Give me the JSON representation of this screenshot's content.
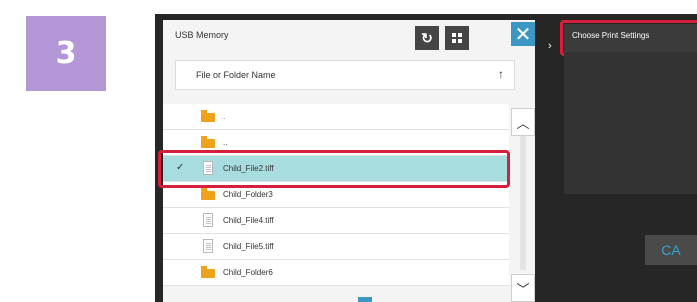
{
  "step_number": "3",
  "panel": {
    "title": "USB Memory",
    "refresh_icon": "refresh-icon",
    "grid_icon": "grid-view-icon",
    "close_icon": "close-icon",
    "sort_label": "File or Folder Name",
    "sort_arrow": "↑"
  },
  "files": [
    {
      "name": ".",
      "type": "folder",
      "selected": false
    },
    {
      "name": "..",
      "type": "folder",
      "selected": false
    },
    {
      "name": "Child_File2.tiff",
      "type": "file",
      "selected": true
    },
    {
      "name": "Child_Folder3",
      "type": "folder",
      "selected": false
    },
    {
      "name": "Child_File4.tiff",
      "type": "file",
      "selected": false
    },
    {
      "name": "Child_File5.tiff",
      "type": "file",
      "selected": false
    },
    {
      "name": "Child_Folder6",
      "type": "folder",
      "selected": false
    }
  ],
  "scroll": {
    "up_icon": "chevron-up-icon",
    "down_icon": "chevron-down-icon"
  },
  "right_panel": {
    "header": "Choose Print Settings",
    "ca_label": "CA"
  },
  "colors": {
    "highlight": "#d61f3b",
    "selected_row": "#a8dde0",
    "accent": "#3d97c4",
    "badge": "#b497d6"
  }
}
